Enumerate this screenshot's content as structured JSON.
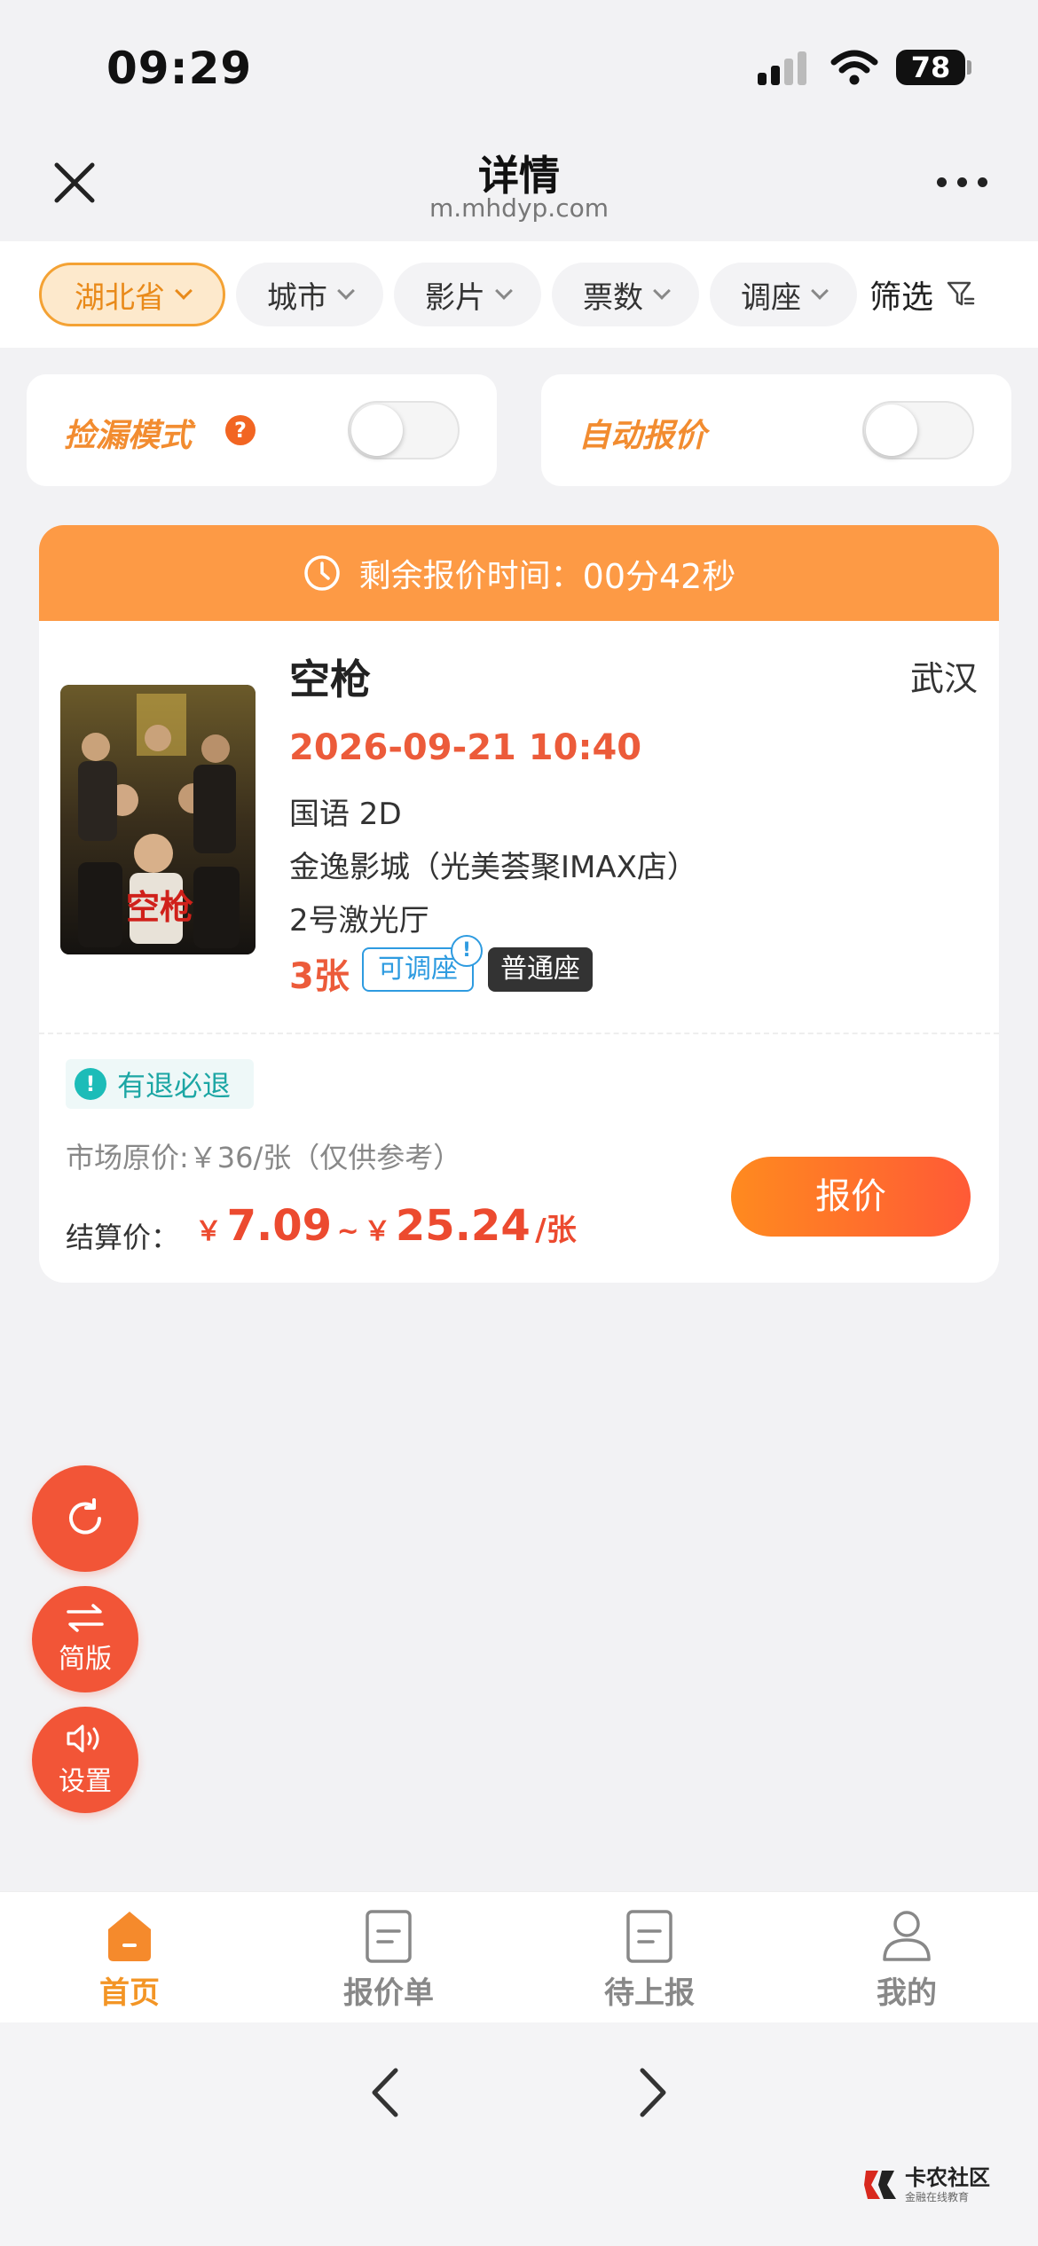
{
  "status_bar": {
    "time": "09:29",
    "battery": "78"
  },
  "header": {
    "title": "详情",
    "url": "m.mhdyp.com"
  },
  "filters": {
    "chips": [
      {
        "label": "湖北省",
        "active": true
      },
      {
        "label": "城市",
        "active": false
      },
      {
        "label": "影片",
        "active": false
      },
      {
        "label": "票数",
        "active": false
      },
      {
        "label": "调座",
        "active": false
      }
    ],
    "screen_label": "筛选"
  },
  "toggles": {
    "pick_mode": {
      "label": "捡漏模式",
      "help": "?",
      "on": false
    },
    "auto_quote": {
      "label": "自动报价",
      "on": false
    }
  },
  "order": {
    "timer_label": "剩余报价时间：",
    "timer_value": "00分42秒",
    "poster_text": "空枪",
    "movie_title": "空枪",
    "city": "武汉",
    "showtime": "2026-09-21 10:40",
    "language_format": "国语 2D",
    "cinema": "金逸影城（光美荟聚IMAX店）",
    "hall": "2号激光厅",
    "quantity": "3张",
    "adjustable_tag": "可调座",
    "seat_tag": "普通座",
    "refund_tag": "有退必退",
    "market_price": "市场原价:￥36/张（仅供参考）",
    "settle_label": "结算价：",
    "currency": "￥",
    "price_min": "7.09",
    "tilde": "~",
    "price_max": "25.24",
    "price_unit": "/张",
    "quote_button": "报价"
  },
  "fabs": {
    "simple_label": "简版",
    "settings_label": "设置"
  },
  "tabbar": {
    "items": [
      {
        "label": "首页",
        "icon": "home-icon",
        "active": true
      },
      {
        "label": "报价单",
        "icon": "document-icon",
        "active": false
      },
      {
        "label": "待上报",
        "icon": "document-icon",
        "active": false
      },
      {
        "label": "我的",
        "icon": "person-icon",
        "active": false
      }
    ]
  },
  "watermark": {
    "title": "卡农社区",
    "subtitle": "金融在线教育"
  },
  "colors": {
    "accent_orange": "#fd9a45",
    "price_red": "#ec4a2f",
    "fab_red": "#f25537",
    "teal": "#1cbcb8",
    "blue": "#2e9be0"
  }
}
